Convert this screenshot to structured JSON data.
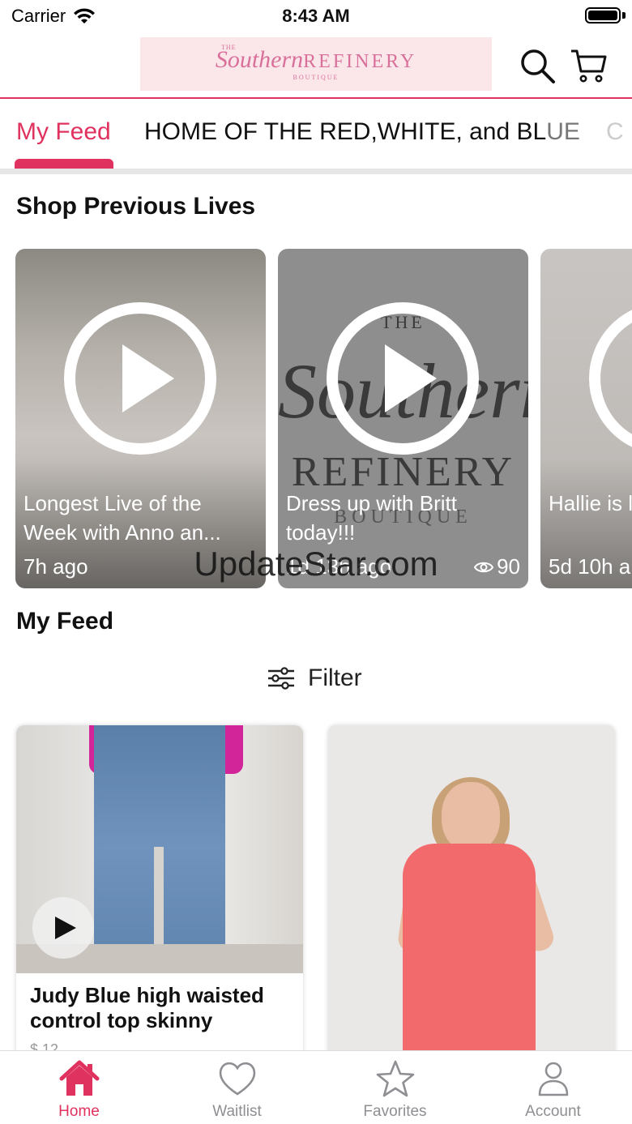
{
  "status": {
    "carrier": "Carrier",
    "time": "8:43 AM"
  },
  "header": {
    "logo_the": "THE",
    "logo_script": "Southern",
    "logo_refinery": "REFINERY",
    "logo_boutique": "BOUTIQUE"
  },
  "tabs": [
    {
      "label": "My Feed",
      "active": true
    },
    {
      "label": "HOME OF THE RED,WHITE, and BL",
      "label_fade": "UE"
    },
    {
      "label": "C"
    }
  ],
  "sections": {
    "previous_lives": "Shop Previous Lives",
    "my_feed": "My Feed"
  },
  "lives": [
    {
      "title": "Longest Live of the Week with Anno an...",
      "time": "7h ago",
      "views": ""
    },
    {
      "title": "Dress up with Britt today!!!",
      "time": "1d 13h ago",
      "views": "90"
    },
    {
      "title": "Hallie is live toda",
      "time": "5d 10h a",
      "views": ""
    }
  ],
  "brand_card": {
    "the": "THE",
    "script": "Southern",
    "refinery": "REFINERY",
    "boutique": "BOUTIQUE"
  },
  "watermark": "UpdateStar.com",
  "filter_label": "Filter",
  "feed": [
    {
      "title": "Judy Blue high waisted control top skinny",
      "price": "$ 12"
    },
    {
      "title": ""
    }
  ],
  "tabbar": [
    {
      "label": "Home",
      "icon": "house-icon",
      "active": true
    },
    {
      "label": "Waitlist",
      "icon": "heart-icon"
    },
    {
      "label": "Favorites",
      "icon": "star-icon"
    },
    {
      "label": "Account",
      "icon": "person-icon"
    }
  ],
  "colors": {
    "accent": "#e0325f",
    "inactive": "#8e8e93",
    "logo_bg": "#fbe6ea",
    "logo_text": "#d9709a"
  }
}
